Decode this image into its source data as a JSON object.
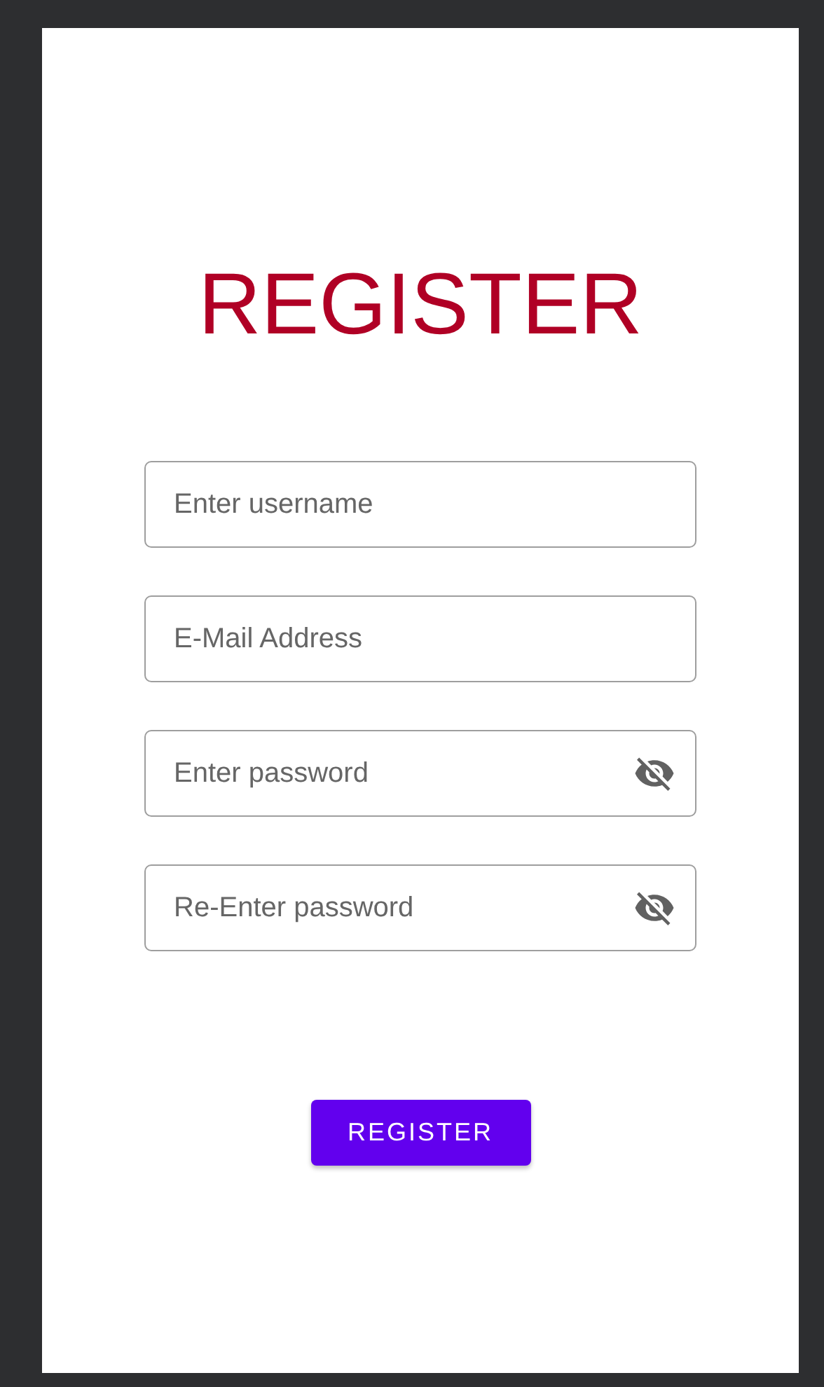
{
  "title": "REGISTER",
  "fields": [
    {
      "placeholder": "Enter username",
      "kind": "text"
    },
    {
      "placeholder": "E-Mail Address",
      "kind": "text"
    },
    {
      "placeholder": "Enter password",
      "kind": "password"
    },
    {
      "placeholder": "Re-Enter password",
      "kind": "password"
    }
  ],
  "button": "REGISTER"
}
